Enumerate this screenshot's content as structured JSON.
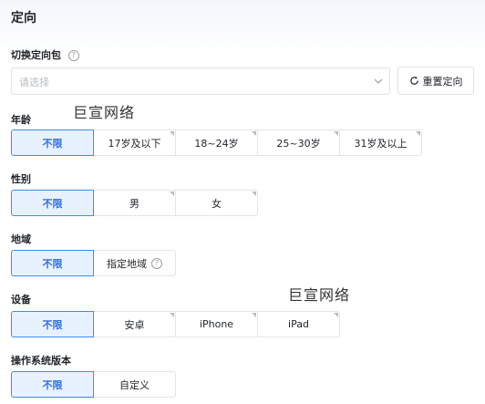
{
  "page": {
    "title": "定向"
  },
  "package": {
    "label": "切换定向包",
    "help_icon": "?",
    "placeholder": "请选择",
    "reset_label": "重置定向"
  },
  "watermarks": [
    "巨宣网络",
    "巨宣网络"
  ],
  "age": {
    "label": "年龄",
    "options": [
      "不限",
      "17岁及以下",
      "18~24岁",
      "25~30岁",
      "31岁及以上"
    ]
  },
  "gender": {
    "label": "性别",
    "options": [
      "不限",
      "男",
      "女"
    ]
  },
  "region": {
    "label": "地域",
    "options": [
      "不限",
      "指定地域"
    ],
    "help_icon": "?"
  },
  "device": {
    "label": "设备",
    "options": [
      "不限",
      "安卓",
      "iPhone",
      "iPad"
    ]
  },
  "os_version": {
    "label": "操作系统版本",
    "options": [
      "不限",
      "自定义"
    ]
  },
  "colors": {
    "accent": "#2f6fe3",
    "accent_bg": "#e8f2ff",
    "border": "#e3e5e8"
  }
}
